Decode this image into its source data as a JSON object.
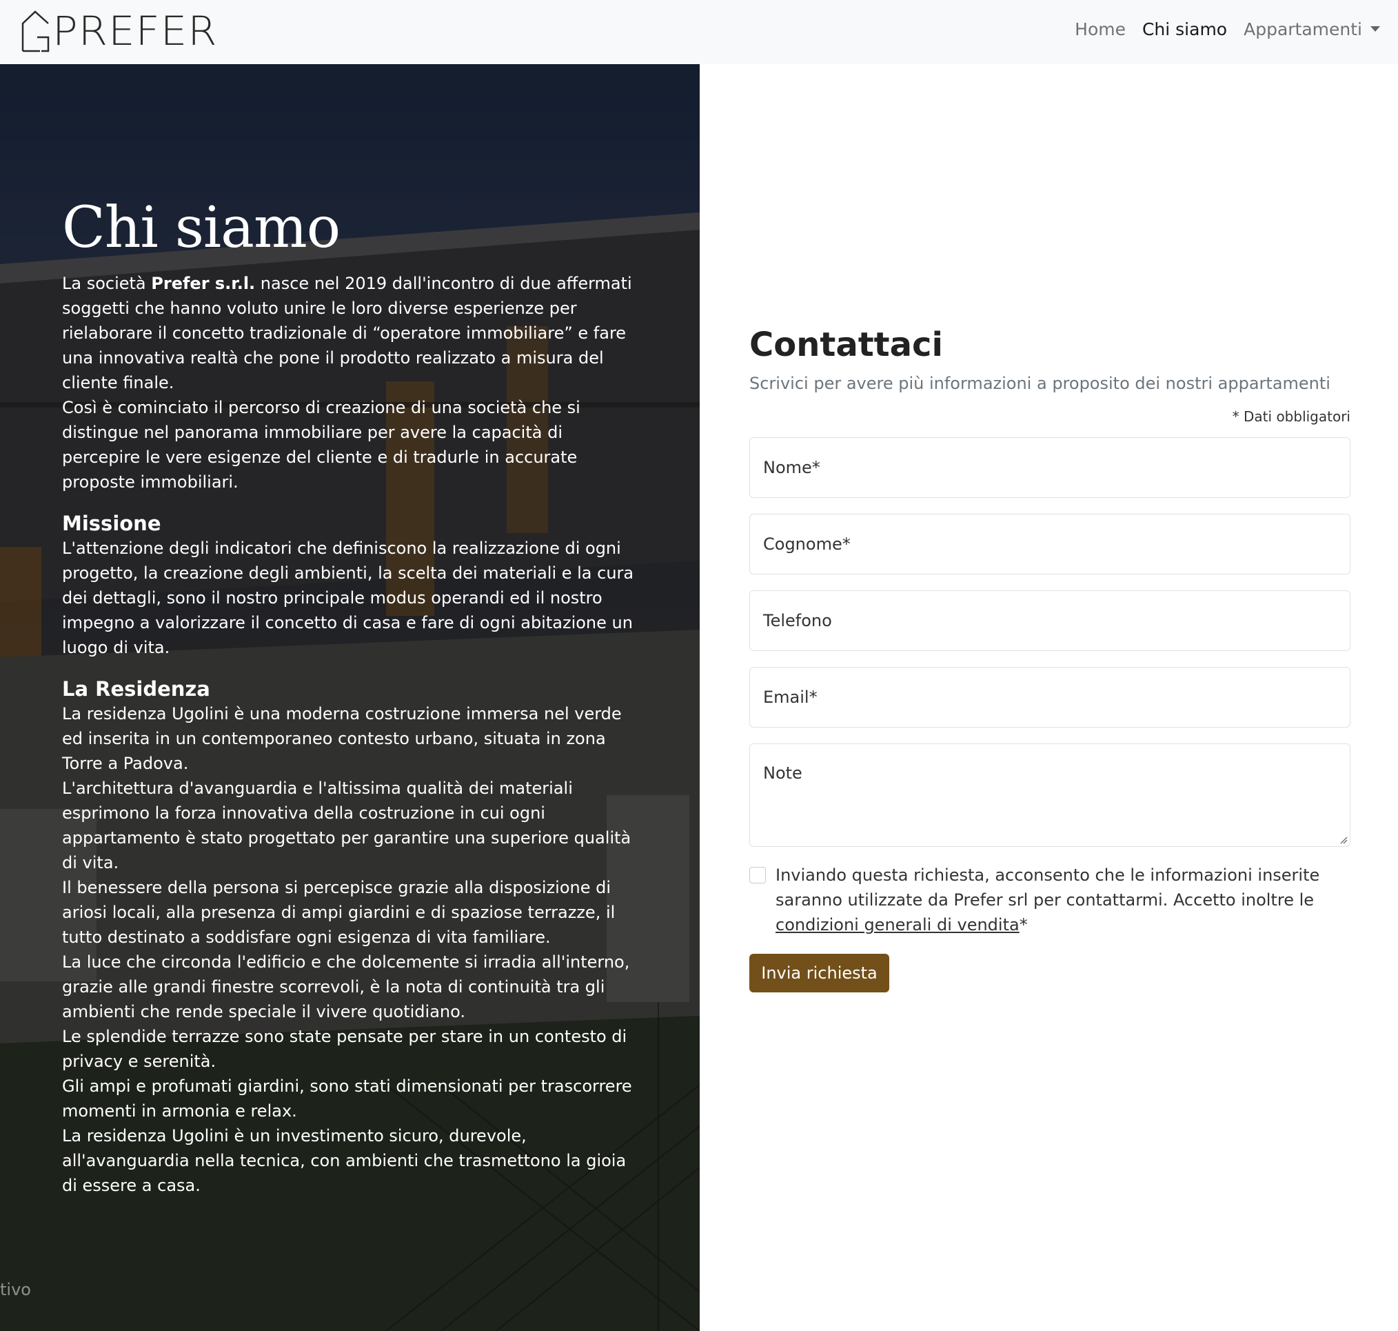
{
  "brand": {
    "logo_text": "PREFER"
  },
  "nav": {
    "items": [
      {
        "label": "Home"
      },
      {
        "label": "Chi siamo"
      },
      {
        "label": "Appartamenti"
      }
    ]
  },
  "about": {
    "title": "Chi siamo",
    "intro_pre": "La società ",
    "intro_bold": "Prefer s.r.l.",
    "intro_post": " nasce nel 2019 dall'incontro di due affermati soggetti che hanno voluto unire le loro diverse esperienze per rielaborare il concetto tradizionale di “operatore immobiliare” e fare una innovativa realtà che pone il prodotto realizzato a misura del cliente finale.",
    "intro_2": "Così è cominciato il percorso di creazione di una società che si distingue nel panorama immobiliare per avere la capacità di percepire le vere esigenze del cliente e di tradurle in accurate proposte immobiliari.",
    "mission_title": "Missione",
    "mission_text": "L'attenzione degli indicatori che definiscono la realizzazione di ogni progetto, la creazione degli ambienti, la scelta dei materiali e la cura dei dettagli, sono il nostro principale modus operandi ed il nostro impegno a valorizzare il concetto di casa e fare di ogni abitazione un luogo di vita.",
    "residence_title": "La Residenza",
    "residence_paragraphs": [
      "La residenza Ugolini è una moderna costruzione immersa nel verde ed inserita in un contemporaneo contesto urbano, situata in zona Torre a Padova.",
      "L'architettura d'avanguardia e l'altissima qualità dei materiali esprimono la forza innovativa della costruzione in cui ogni appartamento è stato progettato per garantire una superiore qualità di vita.",
      "Il benessere della persona si percepisce grazie alla disposizione di ariosi locali, alla presenza di ampi giardini e di spaziose terrazze, il tutto destinato a soddisfare ogni esigenza di vita familiare.",
      "La luce che circonda l'edificio e che dolcemente si irradia all'interno, grazie alle grandi finestre scorrevoli, è la nota di continuità tra gli ambienti che rende speciale il vivere quotidiano.",
      "Le splendide terrazze sono state pensate per stare in un contesto di privacy e serenità.",
      "Gli ampi e profumati giardini, sono stati dimensionati per trascorrere momenti in armonia e relax.",
      "La residenza Ugolini è un investimento sicuro, durevole, all'avanguardia nella tecnica, con ambienti che trasmettono la gioia di essere a casa."
    ],
    "watermark": "tivo"
  },
  "contact": {
    "title": "Contattaci",
    "subtitle": "Scrivici per avere più informazioni a proposito dei nostri appartamenti",
    "required_note": "* Dati obbligatori",
    "fields": {
      "nome": "Nome*",
      "cognome": "Cognome*",
      "telefono": "Telefono",
      "email": "Email*",
      "note": "Note"
    },
    "consent_text": "Inviando questa richiesta, acconsento che le informazioni inserite saranno utilizzate da Prefer srl per contattarmi. Accetto inoltre le ",
    "consent_link": "condizioni generali di vendita",
    "consent_suffix": "*",
    "submit_label": "Invia richiesta"
  },
  "colors": {
    "accent_button": "#73501a",
    "navbar_bg": "#f8f9fa"
  }
}
